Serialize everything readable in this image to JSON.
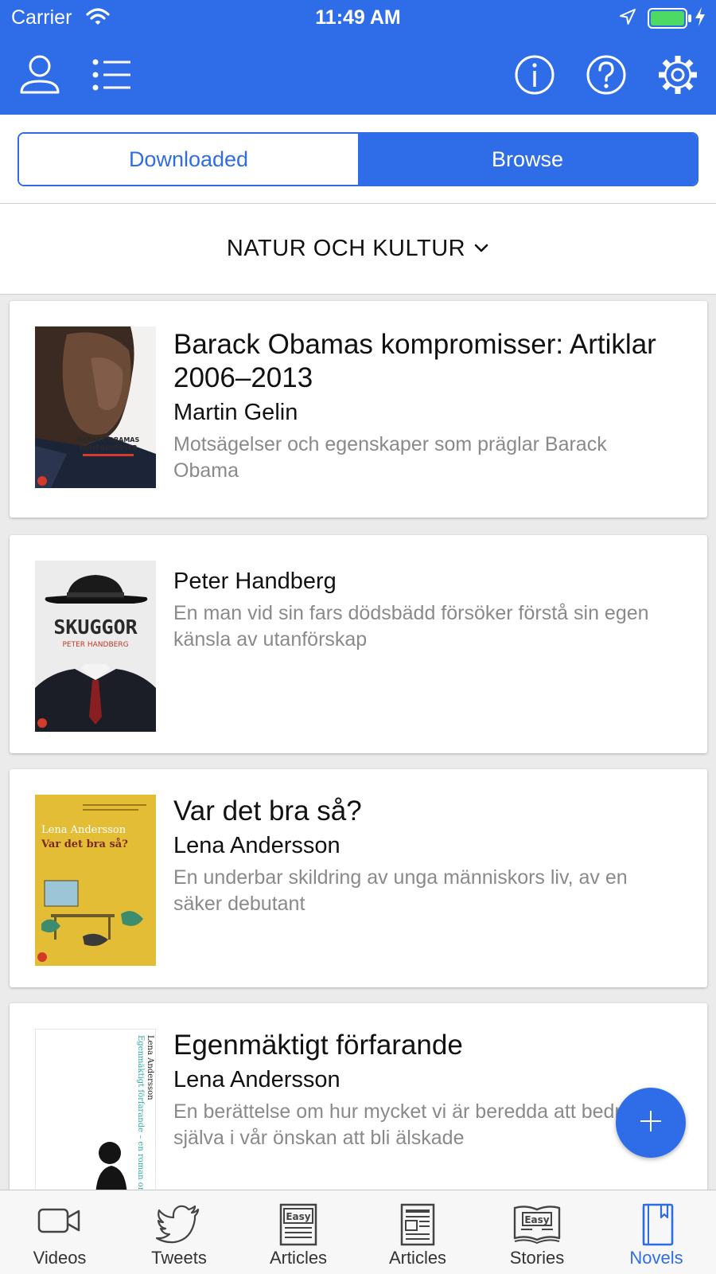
{
  "status_bar": {
    "carrier": "Carrier",
    "time": "11:49 AM"
  },
  "nav": {
    "icons": [
      "person-icon",
      "list-icon",
      "info-icon",
      "help-icon",
      "gear-icon"
    ]
  },
  "segments": {
    "downloaded": "Downloaded",
    "browse": "Browse",
    "selected": "Browse"
  },
  "publisher": {
    "label": "NATUR OCH KULTUR"
  },
  "books": [
    {
      "title": "Barack Obamas kompromisser: Artiklar 2006–2013",
      "author": "Martin Gelin",
      "description": "Motsägelser och egenskaper som präglar Barack Obama"
    },
    {
      "title": "",
      "author": "Peter Handberg",
      "description": "En man vid sin fars dödsbädd försöker förstå sin egen känsla av utanförskap"
    },
    {
      "title": "Var det bra så?",
      "author": "Lena Andersson",
      "description": "En underbar skildring av unga människors liv, av en säker debutant"
    },
    {
      "title": "Egenmäktigt förfarande",
      "author": "Lena Andersson",
      "description": "En berättelse om hur mycket vi är beredda att bedra oss själva i vår önskan att bli älskade"
    }
  ],
  "covers": {
    "obama": {
      "line1": "BARACK OBAMAS",
      "line2": "KOMPROMISSER"
    },
    "skuggor": {
      "title": "SKUGGOR",
      "author": "PETER HANDBERG"
    },
    "vardet": {
      "author": "Lena Andersson",
      "title": "Var det bra så?"
    },
    "egen": {
      "title": "Egenmäktigt förfarande – en roman om kärlek",
      "author": "Lena Andersson"
    }
  },
  "tabs": [
    {
      "label": "Videos",
      "icon": "video-camera-icon"
    },
    {
      "label": "Tweets",
      "icon": "twitter-bird-icon"
    },
    {
      "label": "Articles",
      "icon": "easy-articles-icon",
      "badge": "Easy"
    },
    {
      "label": "Articles",
      "icon": "newspaper-icon"
    },
    {
      "label": "Stories",
      "icon": "easy-stories-book-icon",
      "badge": "Easy"
    },
    {
      "label": "Novels",
      "icon": "novel-book-icon"
    }
  ],
  "active_tab": "Novels",
  "colors": {
    "accent": "#2f6de8",
    "battery": "#4cd964",
    "secondary_text": "#8a8a8a"
  }
}
